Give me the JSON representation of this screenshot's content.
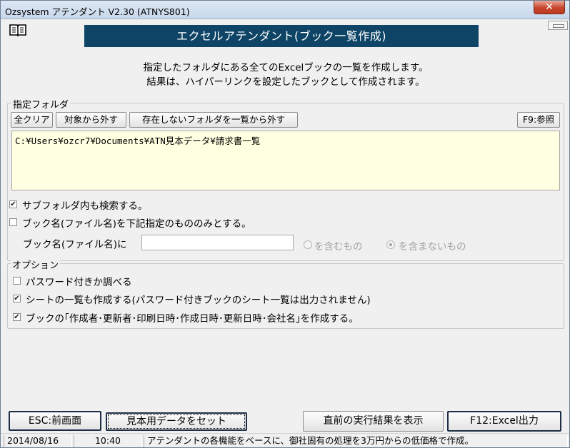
{
  "window": {
    "title": "Ozsystem アテンダント V2.30 (ATNYS801)",
    "close_glyph": "✕"
  },
  "banner": {
    "title": "エクセルアテンダント(ブック一覧作成)"
  },
  "description": {
    "line1": "指定したフォルダにある全てのExcelブックの一覧を作成します。",
    "line2": "結果は、ハイパーリンクを設定したブックとして作成されます。"
  },
  "folder_group": {
    "label": "指定フォルダ",
    "clear_all": "全クリア",
    "exclude": "対象から外す",
    "remove_missing": "存在しないフォルダを一覧から外す",
    "browse": "F9:参照",
    "folder_path": "C:¥Users¥ozcr7¥Documents¥ATN見本データ¥請求書一覧"
  },
  "search_options": {
    "subfolders": {
      "label": "サブフォルダ内も検索する。",
      "checked": true
    },
    "name_filter": {
      "label": "ブック名(ファイル名)を下記指定のもののみとする。",
      "checked": false
    },
    "name_label": "ブック名(ファイル名)に",
    "name_value": "",
    "contains": "を含むもの",
    "not_contains": "を含まないもの"
  },
  "options_group": {
    "label": "オプション",
    "password": {
      "label": "パスワード付きか調べる",
      "checked": false
    },
    "sheet_list": {
      "label": "シートの一覧も作成する(パスワード付きブックのシート一覧は出力されません)",
      "checked": true
    },
    "book_info": {
      "label": "ブックの｢作成者･更新者･印刷日時･作成日時･更新日時･会社名｣を作成する。",
      "checked": true
    }
  },
  "footer": {
    "esc": "ESC:前画面",
    "sample": "見本用データをセット",
    "last_result": "直前の実行結果を表示",
    "excel": "F12:Excel出力"
  },
  "status": {
    "date": "2014/08/16",
    "time": "10:40",
    "message": "アテンダントの各機能をベースに、御社固有の処理を3万円からの低価格で作成。"
  },
  "check_glyph": "✔"
}
